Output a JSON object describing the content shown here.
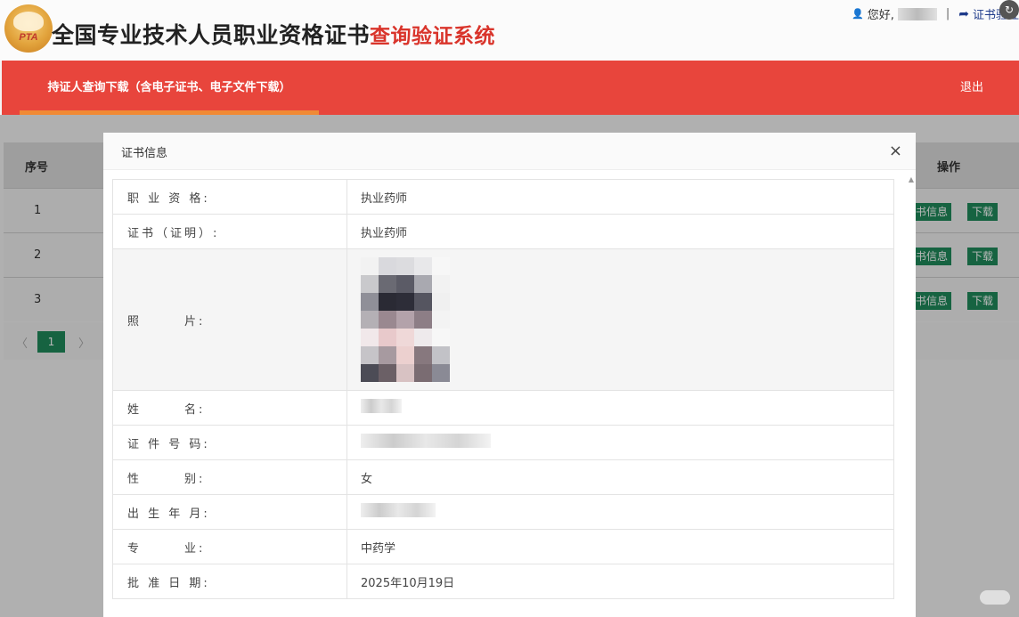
{
  "header": {
    "logo_text": "PTA",
    "title_main": "全国专业技术人员职业资格证书",
    "title_sub": "查询验证系统",
    "greeting": "您好,",
    "verify_link": "证书验证"
  },
  "nav": {
    "tab_label": "持证人查询下载（含电子证书、电子文件下载）",
    "logout": "退出"
  },
  "table": {
    "headers": [
      "序号",
      "操作"
    ],
    "rows": [
      {
        "num": "1",
        "info_btn": "书信息",
        "dl_btn": "下载"
      },
      {
        "num": "2",
        "info_btn": "书信息",
        "dl_btn": "下载"
      },
      {
        "num": "3",
        "info_btn": "书信息",
        "dl_btn": "下载"
      }
    ],
    "pager": {
      "prev": "〈",
      "page": "1",
      "next": "〉"
    }
  },
  "modal": {
    "title": "证书信息",
    "close": "×",
    "rows": [
      {
        "label": "职 业 资 格:",
        "value": "执业药师"
      },
      {
        "label": "证书（证明）:",
        "value": "执业药师"
      },
      {
        "label": "照　　　片:",
        "value": ""
      },
      {
        "label": "姓　　　名:",
        "value": ""
      },
      {
        "label": "证 件 号 码:",
        "value": ""
      },
      {
        "label": "性　　　别:",
        "value": "女"
      },
      {
        "label": "出 生 年 月:",
        "value": ""
      },
      {
        "label": "专　　　业:",
        "value": "中药学"
      },
      {
        "label": "批 准 日 期:",
        "value": "2025年10月19日"
      }
    ]
  },
  "colors": {
    "nav_red": "#e8453c",
    "tab_underline": "#f08a35",
    "title_red": "#d9342b",
    "button_green": "#1f8a5b"
  }
}
